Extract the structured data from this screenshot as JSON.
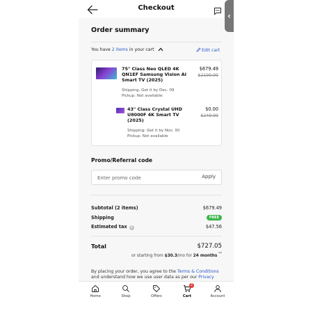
{
  "header": {
    "title": "Checkout",
    "side_tab_glyph": "‹"
  },
  "summary": {
    "title": "Order summary",
    "cart_line_prefix": "You have ",
    "cart_line_link": "2 items",
    "cart_line_suffix": " in your cart",
    "edit_cart": "Edit cart"
  },
  "items": [
    {
      "name": "75\" Class Neo QLED 4K QN1EF Samsung Vision AI Smart TV (2025)",
      "shipping": "Shipping: Get it by Dec. 09",
      "pickup": "Pickup: Not available",
      "price": "$679.49",
      "old_price": "$2199.99"
    },
    {
      "name": "43\" Class Crystal UHD U8000F 4K Smart TV (2025)",
      "shipping": "Shipping: Get it by Nov. 30",
      "pickup": "Pickup: Not available",
      "price": "$0.00",
      "old_price": "$249.99"
    }
  ],
  "promo": {
    "title": "Promo/Referral code",
    "placeholder": "Enter promo code",
    "apply": "Apply"
  },
  "totals": {
    "subtotal_label": "Subtotal (2 items)",
    "subtotal_value": "$679.49",
    "shipping_label": "Shipping",
    "shipping_value": "FREE",
    "tax_label": "Estimated tax",
    "tax_value": "$47.56",
    "total_label": "Total",
    "total_value": "$727.05",
    "installment_prefix": "or starting from ",
    "installment_amount": "$30.3",
    "installment_mid": "/mo for ",
    "installment_term": "24 months",
    "installment_note": "**"
  },
  "legal": {
    "prefix": "By placing your order, you agree to the ",
    "terms_link": "Terms & Conditions",
    "middle": " and understand how we use user data as per our ",
    "privacy_link": "Privacy"
  },
  "nav": [
    {
      "label": "Home",
      "icon": "home-icon"
    },
    {
      "label": "Shop",
      "icon": "search-icon"
    },
    {
      "label": "Offers",
      "icon": "tag-icon"
    },
    {
      "label": "Cart",
      "icon": "cart-icon",
      "badge": "2",
      "active": true
    },
    {
      "label": "Account",
      "icon": "person-icon"
    }
  ],
  "colors": {
    "link": "#2756c8",
    "free_badge": "#3bb54a",
    "cart_badge": "#e53935"
  }
}
